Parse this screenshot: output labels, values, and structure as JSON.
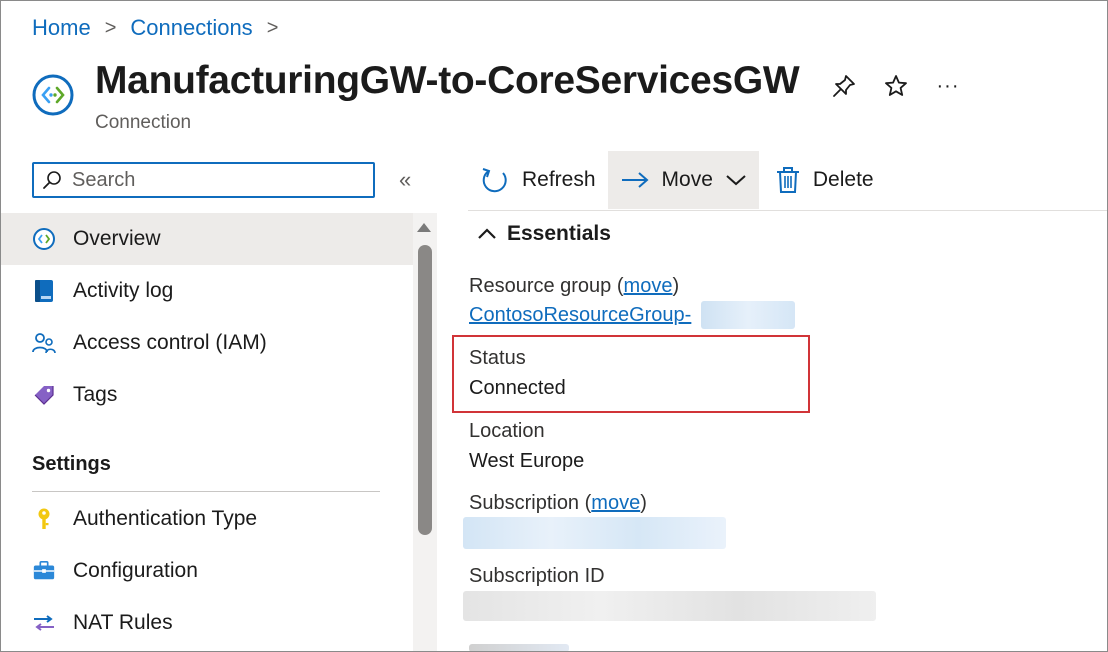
{
  "breadcrumb": {
    "home": "Home",
    "connections": "Connections",
    "separator": ">"
  },
  "resource": {
    "title": "ManufacturingGW-to-CoreServicesGW",
    "type": "Connection"
  },
  "title_actions": {
    "pin": "pin-icon",
    "favorite": "star-icon",
    "more": "···"
  },
  "search": {
    "placeholder": "Search",
    "collapse": "«"
  },
  "nav": {
    "items": [
      {
        "label": "Overview",
        "icon": "connection-icon",
        "active": true
      },
      {
        "label": "Activity log",
        "icon": "activity-log-icon"
      },
      {
        "label": "Access control (IAM)",
        "icon": "people-icon"
      },
      {
        "label": "Tags",
        "icon": "tag-icon"
      }
    ],
    "settings_header": "Settings",
    "settings_items": [
      {
        "label": "Authentication Type",
        "icon": "key-icon"
      },
      {
        "label": "Configuration",
        "icon": "briefcase-icon"
      },
      {
        "label": "NAT Rules",
        "icon": "nat-rules-icon"
      }
    ]
  },
  "toolbar": {
    "refresh": "Refresh",
    "move": "Move",
    "delete": "Delete"
  },
  "essentials": {
    "header": "Essentials",
    "resource_group_label": "Resource group",
    "move_link": "move",
    "resource_group_value": "ContosoResourceGroup-",
    "status_label": "Status",
    "status_value": "Connected",
    "location_label": "Location",
    "location_value": "West Europe",
    "subscription_label": "Subscription",
    "subscription_id_label": "Subscription ID"
  },
  "colors": {
    "accent": "#0f6cbd",
    "highlight": "#d13438",
    "selected": "#edebe9"
  }
}
